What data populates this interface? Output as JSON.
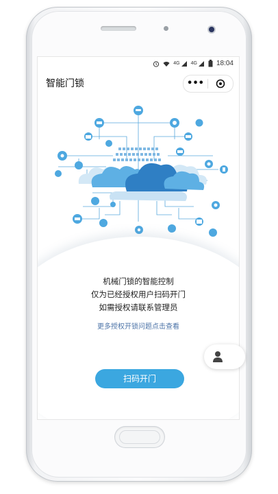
{
  "status_bar": {
    "network_4g_1": "4G",
    "network_4g_2": "4G",
    "time": "18:04"
  },
  "navbar": {
    "title": "智能门锁",
    "more_label": "•••"
  },
  "content": {
    "description_lines": [
      "机械门锁的智能控制",
      "仅为已经授权用户扫码开门",
      "如需授权请联系管理员"
    ],
    "help_link": "更多授权开锁问题点击查看",
    "scan_button": "扫码开门"
  },
  "icons": {
    "support": "user-icon",
    "status": [
      "alarm-icon",
      "wifi-icon",
      "signal-icon",
      "battery-icon"
    ]
  },
  "colors": {
    "accent": "#3ba7e0",
    "link": "#4d74a8",
    "cloud": "#3d9bd6",
    "node": "#4ea8e0"
  }
}
